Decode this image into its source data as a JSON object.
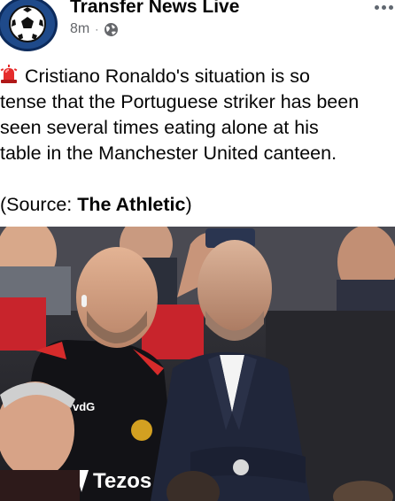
{
  "post": {
    "page_name": "Transfer News Live",
    "time": "8m",
    "separator": "·",
    "privacy_icon": "globe-icon",
    "avatar_icon": "soccer-ball-icon",
    "more_icon": "more-options-icon",
    "status_icon": "siren-icon",
    "text_lines": [
      "Cristiano Ronaldo's situation is so",
      "tense that the Portuguese striker has been",
      "seen several times eating alone at his",
      "table in the Manchester United canteen."
    ],
    "source_prefix": "(Source: ",
    "source_name": "The Athletic",
    "source_suffix": ")"
  },
  "photo": {
    "shirt_text_sponsor": "Tezos",
    "shirt_initials": "vdG"
  },
  "colors": {
    "text": "#050505",
    "meta": "#65676b",
    "avatar_ring": "#0d2b5c",
    "stadium_seats": "#c8242c"
  }
}
